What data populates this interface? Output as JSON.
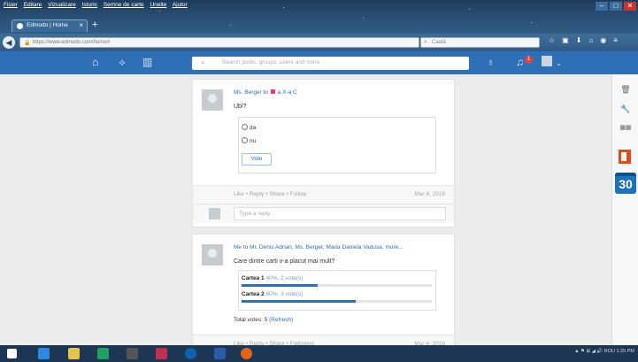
{
  "browser": {
    "menu": [
      "Fișier",
      "Editare",
      "Vizualizare",
      "Istoric",
      "Semne de carte",
      "Unelte",
      "Ajutor"
    ],
    "tab_title": "Edmodo | Home",
    "new_tab": "+",
    "url": "https://www.edmodo.com/home#",
    "search_placeholder": "Caută",
    "window_controls": [
      "–",
      "□",
      "✕"
    ]
  },
  "edmodo_nav": {
    "search_placeholder": "Search posts, groups, users and more",
    "notification_count": "1",
    "brand_color": "#2f6fb6"
  },
  "posts": [
    {
      "sender": "Ms. Berger",
      "to_word": "to",
      "group": "a X-a C",
      "text": "Ubl?",
      "poll_options": [
        "da",
        "nu"
      ],
      "vote_label": "Vote",
      "actions": "Like  •  Reply  •  Share  •  Follow",
      "date": "Mar 4, 2016",
      "reply_placeholder": "Type a reply..."
    },
    {
      "sender": "Me",
      "to_word": "to",
      "recipients": "Mr. Denis Adrian, Ms. Berger, Maria Daniela Vadusa, more...",
      "text": "Care dintre carti v-a placut mai mult?",
      "results": [
        {
          "name": "Cartea 1",
          "stats": "40%, 2 vote(s)",
          "percent": 40
        },
        {
          "name": "Cartea 2",
          "stats": "60%, 3 vote(s)",
          "percent": 60
        }
      ],
      "total_label": "Total votes: 5",
      "refresh_label": "(Refresh)",
      "actions": "Like  •  Reply  •  Share  •  Following",
      "date": "Mar 4, 2016"
    }
  ],
  "sidebar": {
    "calendar_day": "30"
  },
  "taskbar": {
    "tray": "▲ ⚑ ⊞ ◢ 🔊 ROU 1:25 PM"
  }
}
